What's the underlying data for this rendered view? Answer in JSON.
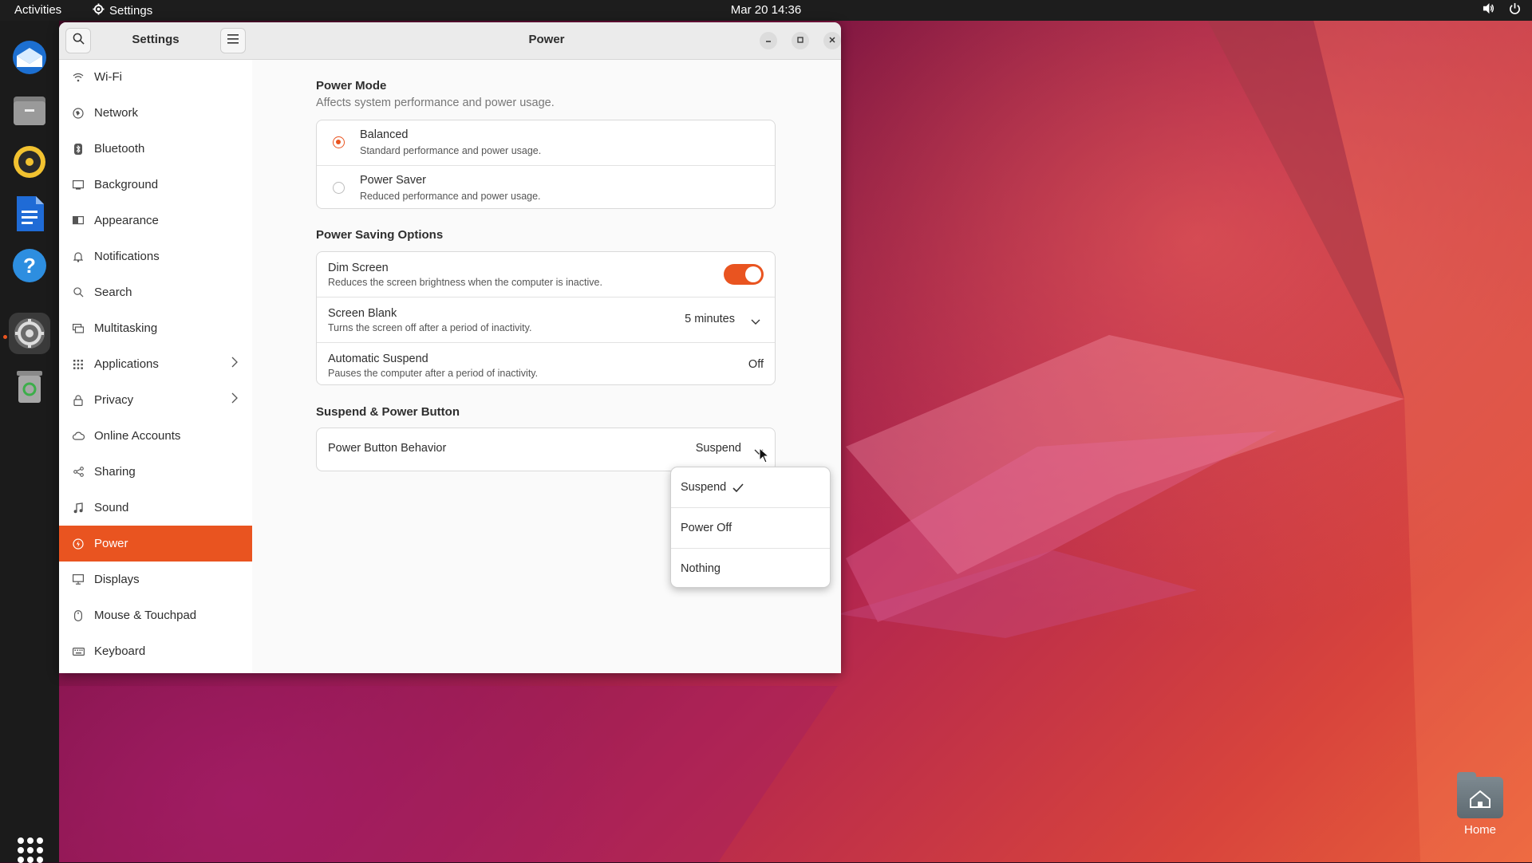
{
  "topbar": {
    "activities": "Activities",
    "app_name": "Settings",
    "clock": "Mar 20  14:36"
  },
  "dock": {
    "items": [
      "thunderbird-icon",
      "files-icon",
      "rhythmbox-icon",
      "writer-icon",
      "help-icon",
      "settings-icon",
      "trash-icon"
    ],
    "active": "settings-icon"
  },
  "desktop": {
    "home_label": "Home"
  },
  "window": {
    "sidebar_title": "Settings",
    "title": "Power"
  },
  "sidebar": {
    "items": [
      {
        "label": "Wi-Fi",
        "icon": "wifi-icon"
      },
      {
        "label": "Network",
        "icon": "network-icon"
      },
      {
        "label": "Bluetooth",
        "icon": "bluetooth-icon"
      },
      {
        "label": "Background",
        "icon": "background-icon"
      },
      {
        "label": "Appearance",
        "icon": "appearance-icon"
      },
      {
        "label": "Notifications",
        "icon": "bell-icon"
      },
      {
        "label": "Search",
        "icon": "search-icon"
      },
      {
        "label": "Multitasking",
        "icon": "multitasking-icon"
      },
      {
        "label": "Applications",
        "icon": "apps-icon",
        "has_submenu": true
      },
      {
        "label": "Privacy",
        "icon": "lock-icon",
        "has_submenu": true
      },
      {
        "label": "Online Accounts",
        "icon": "cloud-icon"
      },
      {
        "label": "Sharing",
        "icon": "share-icon"
      },
      {
        "label": "Sound",
        "icon": "music-icon"
      },
      {
        "label": "Power",
        "icon": "power-icon",
        "selected": true
      },
      {
        "label": "Displays",
        "icon": "display-icon"
      },
      {
        "label": "Mouse & Touchpad",
        "icon": "mouse-icon"
      },
      {
        "label": "Keyboard",
        "icon": "keyboard-icon"
      }
    ]
  },
  "power_mode": {
    "title": "Power Mode",
    "subtitle": "Affects system performance and power usage.",
    "options": [
      {
        "title": "Balanced",
        "desc": "Standard performance and power usage.",
        "selected": true
      },
      {
        "title": "Power Saver",
        "desc": "Reduced performance and power usage.",
        "selected": false
      }
    ]
  },
  "saving": {
    "title": "Power Saving Options",
    "dim": {
      "title": "Dim Screen",
      "desc": "Reduces the screen brightness when the computer is inactive.",
      "enabled": true
    },
    "blank": {
      "title": "Screen Blank",
      "desc": "Turns the screen off after a period of inactivity.",
      "value": "5 minutes"
    },
    "suspend": {
      "title": "Automatic Suspend",
      "desc": "Pauses the computer after a period of inactivity.",
      "value": "Off"
    }
  },
  "button": {
    "title": "Suspend & Power Button",
    "behavior": {
      "title": "Power Button Behavior",
      "value": "Suspend"
    }
  },
  "popover": {
    "options": [
      {
        "label": "Suspend",
        "checked": true
      },
      {
        "label": "Power Off",
        "checked": false
      },
      {
        "label": "Nothing",
        "checked": false
      }
    ]
  },
  "colors": {
    "accent": "#e95420"
  }
}
